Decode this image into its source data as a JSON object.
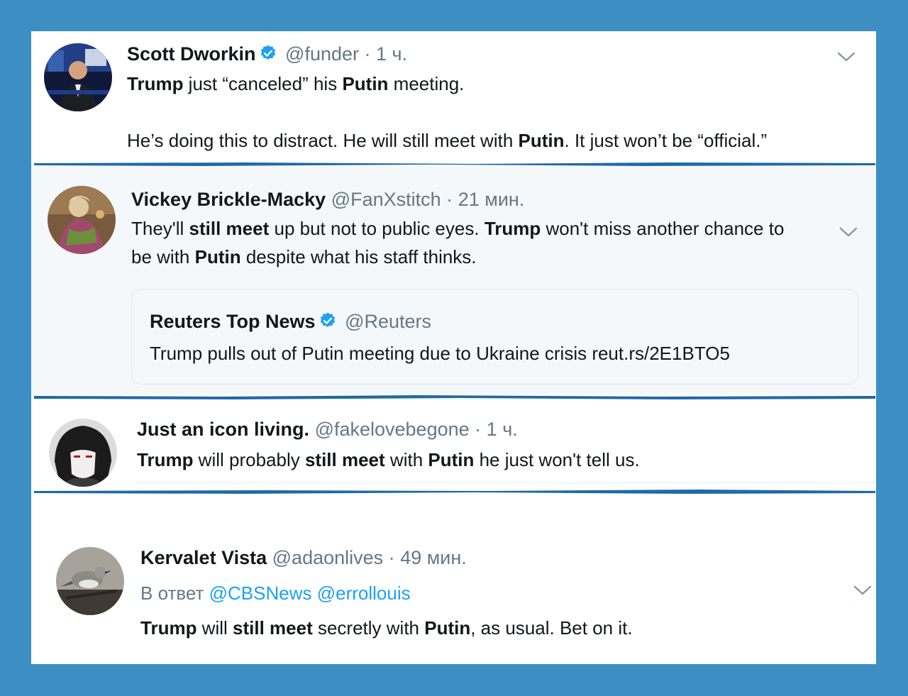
{
  "colors": {
    "frame": "#3d8fc3",
    "separator": "#1f69a8",
    "link": "#1da1f2",
    "muted": "#657786",
    "verified": "#1da1f2"
  },
  "tweets": [
    {
      "name": "Scott Dworkin",
      "verified": true,
      "handle": "@funder",
      "dot": "·",
      "time": "1 ч.",
      "lines": [
        [
          {
            "b": "Trump"
          },
          {
            "t": " just “canceled” his "
          },
          {
            "b": "Putin"
          },
          {
            "t": " meeting."
          }
        ],
        [
          {
            "t": "He’s doing this to distract. He will still meet with "
          },
          {
            "b": "Putin"
          },
          {
            "t": ". It just won’t be “official.”"
          }
        ]
      ]
    },
    {
      "name": "Vickey Brickle-Macky",
      "handle": "@FanXstitch",
      "dot": "·",
      "time": "21 мин.",
      "lines": [
        [
          {
            "t": "They'll "
          },
          {
            "b": "still meet"
          },
          {
            "t": " up but not to public eyes. "
          },
          {
            "b": "Trump"
          },
          {
            "t": " won't miss another chance to"
          }
        ],
        [
          {
            "t": "be with "
          },
          {
            "b": "Putin"
          },
          {
            "t": " despite what his staff thinks."
          }
        ]
      ],
      "quote": {
        "name": "Reuters Top News",
        "verified": true,
        "handle": "@Reuters",
        "text": "Trump pulls out of Putin meeting due to Ukraine crisis reut.rs/2E1BTO5"
      }
    },
    {
      "name": "Just an icon living.",
      "handle": "@fakelovebegone",
      "dot": "·",
      "time": "1 ч.",
      "lines": [
        [
          {
            "b": "Trump"
          },
          {
            "t": " will probably "
          },
          {
            "b": "still meet"
          },
          {
            "t": " with "
          },
          {
            "b": "Putin"
          },
          {
            "t": " he just won't tell us."
          }
        ]
      ]
    },
    {
      "name": "Kervalet Vista",
      "handle": "@adaonlives",
      "dot": "·",
      "time": "49 мин.",
      "reply_label": "В ответ",
      "reply_mentions": [
        "@CBSNews",
        "@errollouis"
      ],
      "lines": [
        [
          {
            "b": "Trump"
          },
          {
            "t": " will "
          },
          {
            "b": "still meet"
          },
          {
            "t": " secretly with "
          },
          {
            "b": "Putin"
          },
          {
            "t": ", as usual. Bet on it."
          }
        ]
      ]
    }
  ]
}
